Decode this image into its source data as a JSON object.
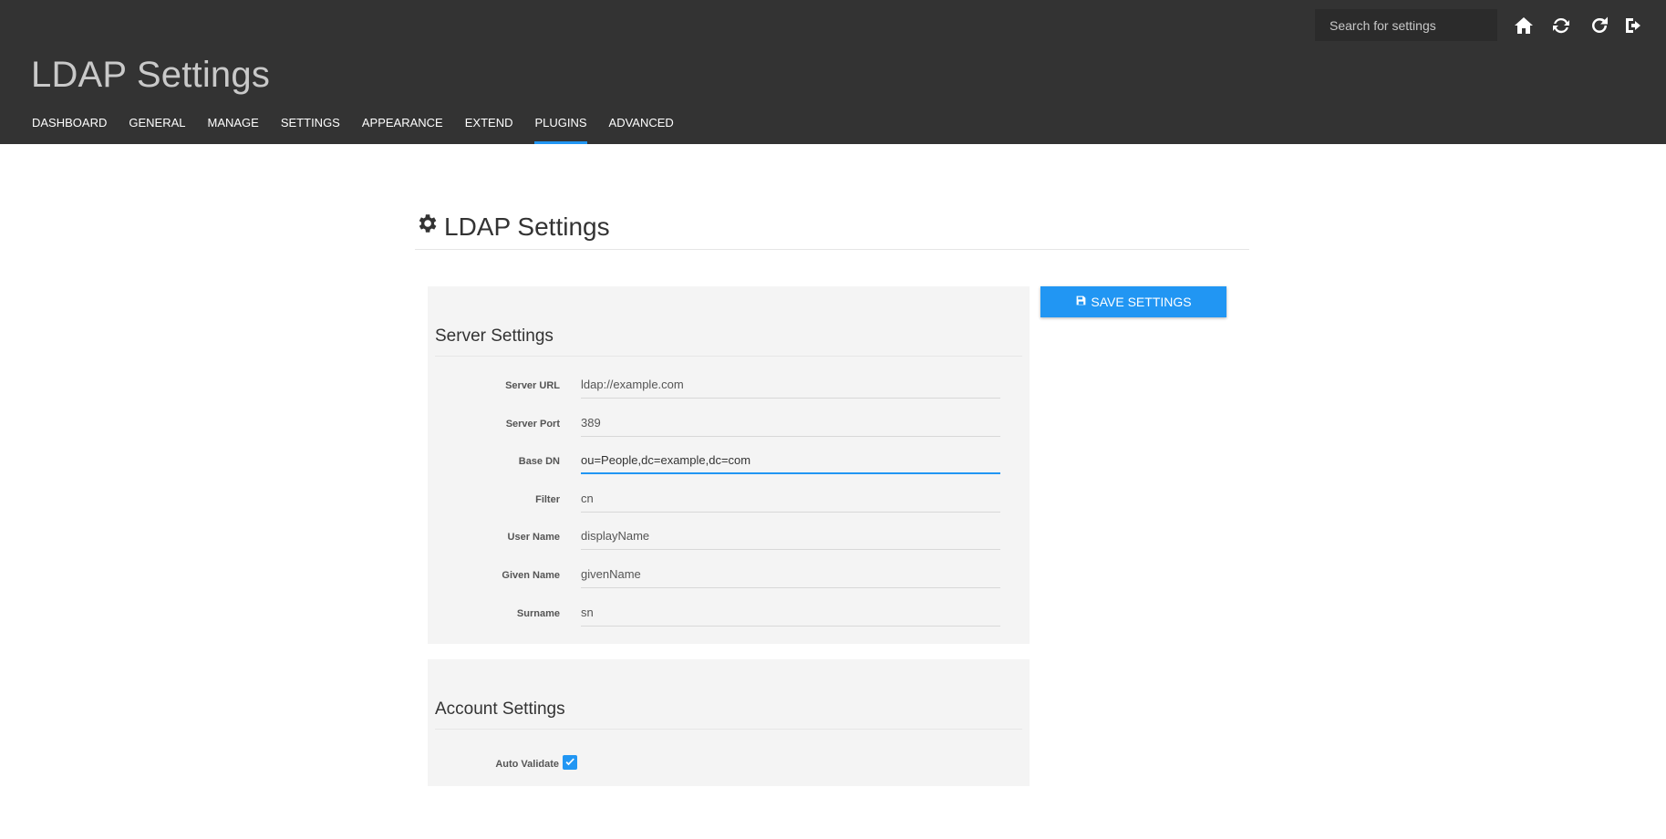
{
  "header": {
    "search_placeholder": "Search for settings",
    "app_title": "LDAP Settings",
    "icons": [
      "home-icon",
      "refresh-icon",
      "reload-icon",
      "logout-icon"
    ]
  },
  "nav": {
    "items": [
      "DASHBOARD",
      "GENERAL",
      "MANAGE",
      "SETTINGS",
      "APPEARANCE",
      "EXTEND",
      "PLUGINS",
      "ADVANCED"
    ],
    "active": "PLUGINS",
    "accent_color": "#2196f3"
  },
  "page": {
    "title": "LDAP Settings",
    "title_icon": "gear-icon"
  },
  "server_settings": {
    "heading": "Server Settings",
    "fields": [
      {
        "label": "Server URL",
        "value": "ldap://example.com"
      },
      {
        "label": "Server Port",
        "value": "389"
      },
      {
        "label": "Base DN",
        "value": "ou=People,dc=example,dc=com"
      },
      {
        "label": "Filter",
        "value": "cn"
      },
      {
        "label": "User Name",
        "value": "displayName"
      },
      {
        "label": "Given Name",
        "value": "givenName"
      },
      {
        "label": "Surname",
        "value": "sn"
      }
    ]
  },
  "account_settings": {
    "heading": "Account Settings",
    "auto_validate_label": "Auto Validate",
    "auto_validate_checked": true
  },
  "actions": {
    "save_label": "SAVE SETTINGS",
    "save_icon": "floppy-disk-icon"
  }
}
